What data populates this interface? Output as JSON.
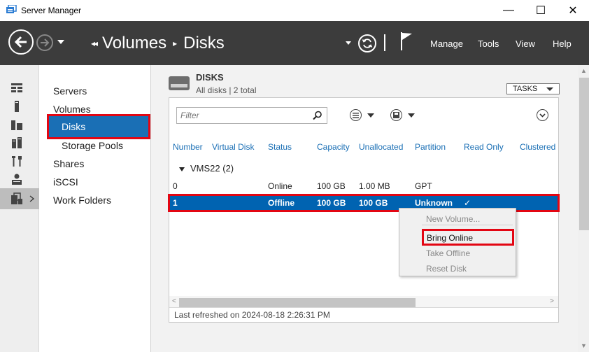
{
  "window": {
    "title": "Server Manager",
    "minimize": "—",
    "maximize": "☐",
    "close": "✕"
  },
  "command_bar": {
    "breadcrumb": [
      "Volumes",
      "Disks"
    ],
    "lead_glyph": "◂◂",
    "separator": "▸",
    "pipe": "|",
    "menus": [
      "Manage",
      "Tools",
      "View",
      "Help"
    ]
  },
  "nav": {
    "items": [
      {
        "label": "Servers"
      },
      {
        "label": "Volumes"
      },
      {
        "label": "Disks",
        "selected": true
      },
      {
        "label": "Storage Pools"
      },
      {
        "label": "Shares"
      },
      {
        "label": "iSCSI"
      },
      {
        "label": "Work Folders"
      }
    ]
  },
  "section": {
    "title": "DISKS",
    "subtitle": "All disks | 2 total",
    "tasks_label": "TASKS"
  },
  "filter": {
    "placeholder": "Filter"
  },
  "table": {
    "columns": [
      "Number",
      "Virtual Disk",
      "Status",
      "Capacity",
      "Unallocated",
      "Partition",
      "Read Only",
      "Clustered"
    ],
    "group": "VMS22 (2)",
    "rows": [
      {
        "number": "0",
        "virtual_disk": "",
        "status": "Online",
        "capacity": "100 GB",
        "unallocated": "1.00 MB",
        "partition": "GPT",
        "read_only": "",
        "clustered": ""
      },
      {
        "number": "1",
        "virtual_disk": "",
        "status": "Offline",
        "capacity": "100 GB",
        "unallocated": "100 GB",
        "partition": "Unknown",
        "read_only": "✓",
        "clustered": "",
        "selected": true
      }
    ],
    "last_refreshed": "Last refreshed on 2024-08-18 2:26:31 PM"
  },
  "context_menu": {
    "items": [
      {
        "label": "New Volume...",
        "enabled": false
      },
      {
        "label": "Bring Online",
        "enabled": true,
        "highlighted": true
      },
      {
        "label": "Take Offline",
        "enabled": false
      },
      {
        "label": "Reset Disk",
        "enabled": false
      }
    ]
  },
  "colors": {
    "command_bar": "#3c3c3c",
    "selection": "#0063b1",
    "highlight_box": "#e30613",
    "column_header": "#1a6fb5"
  }
}
